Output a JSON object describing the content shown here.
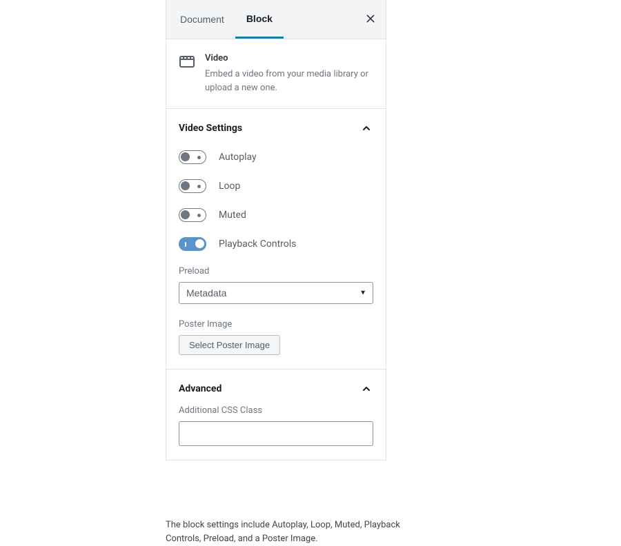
{
  "tabs": {
    "document": "Document",
    "block": "Block"
  },
  "block": {
    "title": "Video",
    "description": "Embed a video from your media library or upload a new one."
  },
  "sections": {
    "video": {
      "title": "Video Settings",
      "toggles": {
        "autoplay": "Autoplay",
        "loop": "Loop",
        "muted": "Muted",
        "playback": "Playback Controls"
      },
      "preload": {
        "label": "Preload",
        "value": "Metadata"
      },
      "poster": {
        "label": "Poster Image",
        "button": "Select Poster Image"
      }
    },
    "advanced": {
      "title": "Advanced",
      "cssclass": {
        "label": "Additional CSS Class",
        "value": ""
      }
    }
  },
  "caption": "The block settings include Autoplay, Loop, Muted, Playback Controls, Preload, and a Poster Image."
}
